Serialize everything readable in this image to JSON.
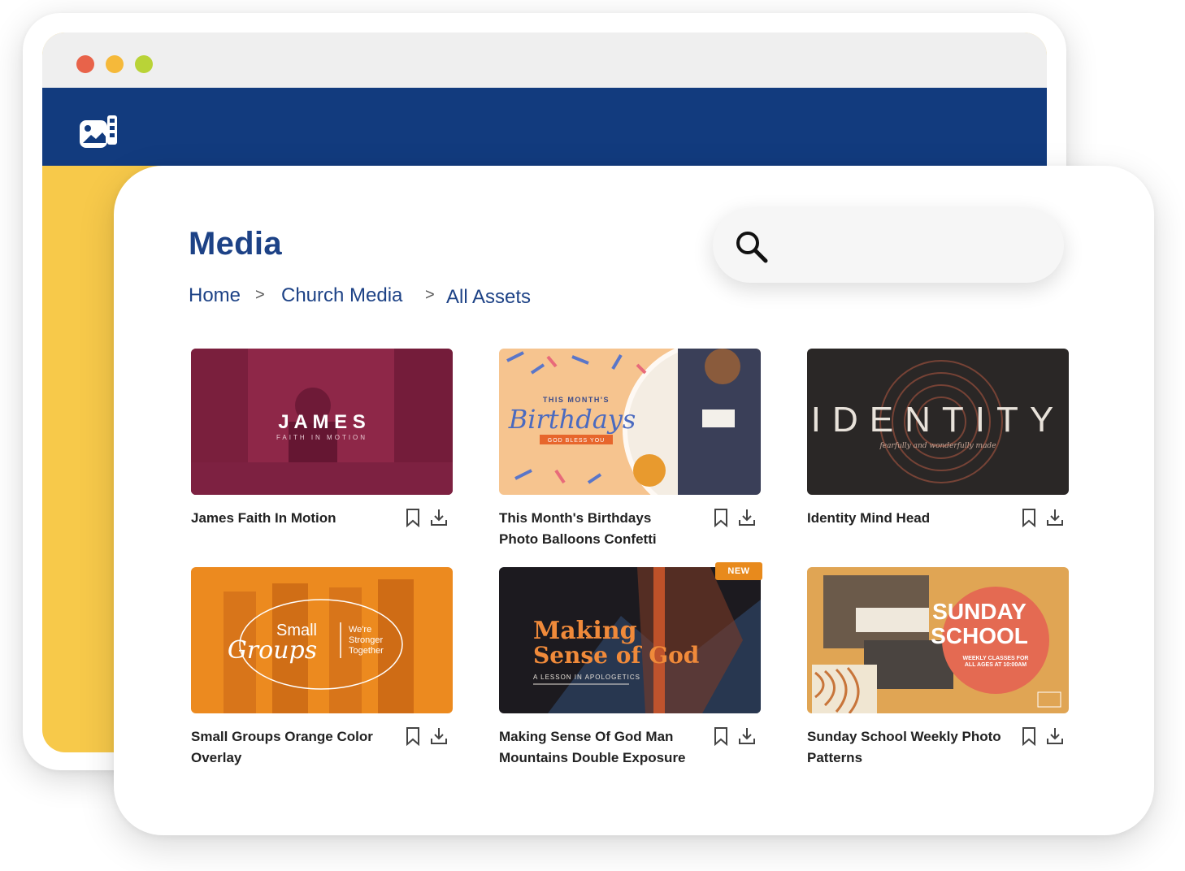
{
  "colors": {
    "brand_blue": "#123b7e",
    "title_blue": "#1d4286",
    "accent_yellow": "#f7c94a",
    "dot_red": "#e8634a",
    "dot_yellow": "#f5b93a",
    "dot_green": "#b9d337",
    "badge_orange": "#e88a1c"
  },
  "app": {
    "logo_icon": "media-library-icon"
  },
  "page": {
    "title": "Media"
  },
  "breadcrumb": {
    "items": [
      "Home",
      "Church Media",
      "All Assets"
    ],
    "separator": ">"
  },
  "search": {
    "placeholder": "",
    "icon": "search-icon"
  },
  "assets": [
    {
      "title": "James Faith In Motion",
      "thumb_text": [
        "J A M E S",
        "FAITH IN MOTION"
      ]
    },
    {
      "title": "This Month's Birthdays Photo Balloons Confetti",
      "thumb_text": [
        "THIS MONTH'S",
        "Birthdays",
        "GOD BLESS YOU"
      ]
    },
    {
      "title": "Identity Mind Head",
      "thumb_text": [
        "IDENTITY",
        "fearfully and wonderfully made"
      ]
    },
    {
      "title": "Small Groups Orange Color Overlay",
      "thumb_text": [
        "Small",
        "Groups",
        "We're",
        "Stronger",
        "Together"
      ]
    },
    {
      "title": "Making Sense Of God Man Mountains Double Exposure",
      "thumb_text": [
        "Making",
        "Sense of God",
        "A LESSON IN APOLOGETICS"
      ],
      "badge": "NEW"
    },
    {
      "title": "Sunday School Weekly Photo Patterns",
      "thumb_text": [
        "SUNDAY",
        "SCHOOL",
        "WEEKLY CLASSES FOR",
        "ALL AGES AT 10:00AM"
      ]
    }
  ],
  "card_actions": {
    "bookmark_icon": "bookmark-icon",
    "download_icon": "download-icon"
  }
}
